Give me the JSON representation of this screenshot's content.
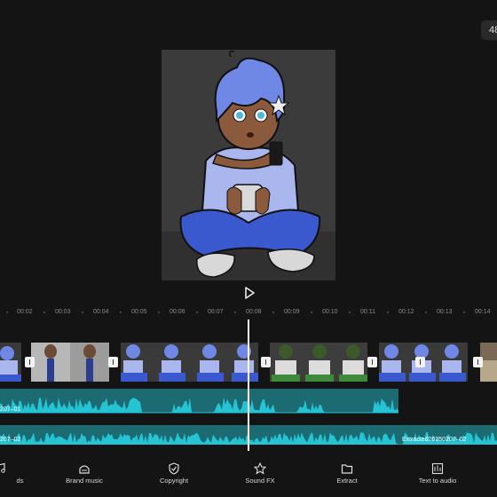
{
  "top_badge": "48",
  "ruler": [
    "00:02",
    "00:03",
    "00:04",
    "00:05",
    "00:06",
    "00:07",
    "00:08",
    "00:09",
    "00:10",
    "00:11",
    "00:12",
    "00:13",
    "00:14"
  ],
  "audio_tracks": {
    "track1_label": "207–01",
    "track2_label_left": "207–02",
    "track2_label_right": "Extracted20250207–02"
  },
  "toolbar": {
    "sounds_label": "ds",
    "brand_music_label": "Brand music",
    "copyright_label": "Copyright",
    "sound_fx_label": "Sound FX",
    "extract_label": "Extract",
    "text_to_audio_label": "Text to audio"
  },
  "colors": {
    "background": "#141414",
    "waveform": "#25c4d4",
    "audio_track": "#1d6b72",
    "playhead": "#ffffff"
  }
}
